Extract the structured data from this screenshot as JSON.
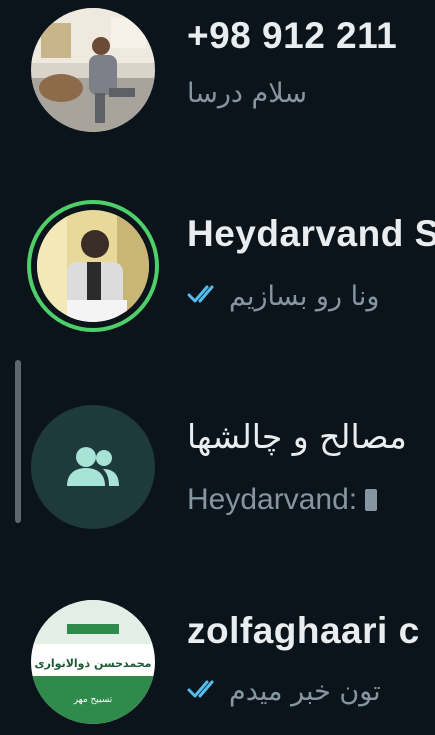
{
  "chats": [
    {
      "title": "+98 912 211",
      "preview": "سلام درسا",
      "avatar": "photo-man-sitting",
      "has_status_ring": false,
      "read_ticks": false
    },
    {
      "title": "Heydarvand S",
      "preview": "ونا رو بسازیم",
      "avatar": "photo-man-writing",
      "has_status_ring": true,
      "read_ticks": true
    },
    {
      "title": "مصالح و چالشها",
      "preview_sender": "Heydarvand:",
      "avatar": "group-icon",
      "has_status_ring": false,
      "read_ticks": false
    },
    {
      "title": "zolfaghaari c",
      "preview": "تون خبر میدم",
      "avatar": "campaign-logo",
      "avatar_text": "محمدحسن ذوالانواری",
      "avatar_small_text": "تسبیح مهر",
      "has_status_ring": false,
      "read_ticks": true
    }
  ],
  "colors": {
    "background": "#0b141a",
    "title": "#e9edef",
    "preview": "#8696a0",
    "read_ticks": "#53bdeb",
    "status_ring": "#4fcf6a",
    "group_avatar_bg": "#1f3a3a",
    "group_icon": "#a7e3d6"
  }
}
